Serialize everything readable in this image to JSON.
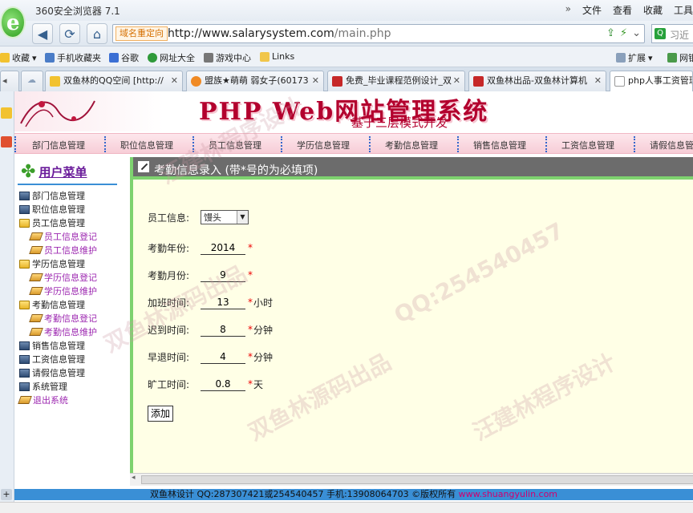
{
  "browser": {
    "title": "360安全浏览器 7.1",
    "menu": [
      "文件",
      "查看",
      "收藏",
      "工具"
    ],
    "menu_arrow": "»",
    "redirect_label": "域名重定向",
    "url_host": "http://www.salarysystem.com",
    "url_path": "/main.php",
    "search_placeholder": "习近"
  },
  "bookmarks": [
    "收藏",
    "手机收藏夹",
    "谷歌",
    "网址大全",
    "游戏中心",
    "Links",
    "扩展",
    "网银"
  ],
  "tabs": [
    {
      "label": "双鱼林的QQ空间 [http://"
    },
    {
      "label": "盟族★萌萌 弱女子(60173"
    },
    {
      "label": "免费_毕业课程范例设计_双"
    },
    {
      "label": "双鱼林出品-双鱼林计算机"
    },
    {
      "label": "php人事工资管理"
    }
  ],
  "banner": {
    "title": "PHP Web网站管理系统",
    "subtitle": "基于三层模式开发"
  },
  "topnav": [
    "部门信息管理",
    "职位信息管理",
    "员工信息管理",
    "学历信息管理",
    "考勤信息管理",
    "销售信息管理",
    "工资信息管理",
    "请假信息管理"
  ],
  "sidebar": {
    "title": "用户菜单",
    "nodes": [
      {
        "label": "部门信息管理",
        "type": "closed"
      },
      {
        "label": "职位信息管理",
        "type": "closed"
      },
      {
        "label": "员工信息管理",
        "type": "folder"
      },
      {
        "label": "员工信息登记",
        "type": "leaf"
      },
      {
        "label": "员工信息维护",
        "type": "leaf"
      },
      {
        "label": "学历信息管理",
        "type": "folder"
      },
      {
        "label": "学历信息登记",
        "type": "leaf"
      },
      {
        "label": "学历信息维护",
        "type": "leaf"
      },
      {
        "label": "考勤信息管理",
        "type": "folder"
      },
      {
        "label": "考勤信息登记",
        "type": "leaf"
      },
      {
        "label": "考勤信息维护",
        "type": "leaf"
      },
      {
        "label": "销售信息管理",
        "type": "closed"
      },
      {
        "label": "工资信息管理",
        "type": "closed"
      },
      {
        "label": "请假信息管理",
        "type": "closed"
      },
      {
        "label": "系统管理",
        "type": "closed"
      },
      {
        "label": "退出系统",
        "type": "leaf"
      }
    ]
  },
  "form": {
    "title": "考勤信息录入 (带*号的为必填项)",
    "employee_label": "员工信息:",
    "employee_value": "馒头",
    "year_label": "考勤年份:",
    "year_value": "2014",
    "month_label": "考勤月份:",
    "month_value": "9",
    "overtime_label": "加班时间:",
    "overtime_value": "13",
    "overtime_unit": "小时",
    "late_label": "迟到时间:",
    "late_value": "8",
    "late_unit": "分钟",
    "early_label": "早退时间:",
    "early_value": "4",
    "early_unit": "分钟",
    "absent_label": "旷工时间:",
    "absent_value": "0.8",
    "absent_unit": "天",
    "required_mark": "*",
    "submit_label": "添加"
  },
  "footer": {
    "text": "双鱼林设计 QQ:287307421或254540457 手机:13908064703 ©版权所有 ",
    "link": "www.shuangyulin.com"
  },
  "watermarks": [
    "汪建林程序设计",
    "QQ:254540457",
    "双鱼林源码出品"
  ]
}
